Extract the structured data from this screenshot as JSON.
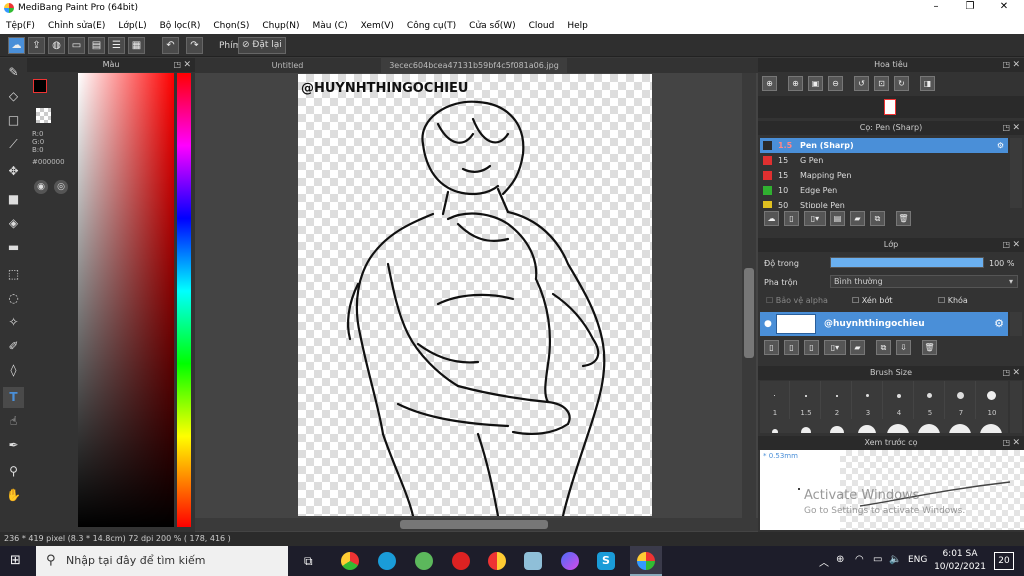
{
  "window": {
    "title": "MediBang Paint Pro (64bit)",
    "min": "–",
    "max": "❐",
    "close": "✕"
  },
  "menu": [
    "Tệp(F)",
    "Chỉnh sửa(E)",
    "Lớp(L)",
    "Bộ lọc(R)",
    "Chọn(S)",
    "Chụp(N)",
    "Màu (C)",
    "Xem(V)",
    "Công cụ(T)",
    "Cửa sổ(W)",
    "Cloud",
    "Help"
  ],
  "toolbar": {
    "phim": "Phím",
    "reset": "Đặt lại"
  },
  "color_panel": {
    "title": "Màu",
    "r": "R:0",
    "g": "G:0",
    "b": "B:0",
    "hex": "#000000"
  },
  "tabs": [
    "Untitled",
    "3ecec604bcea47131b59bf4c5f081a06.jpg"
  ],
  "canvas": {
    "watermark": "@HUYNHTHINGOCHIEU"
  },
  "status": "236 * 419 pixel  (8.3 * 14.8cm)  72 dpi  200 %  ( 178, 416 )",
  "navigator": {
    "title": "Hoa tiêu"
  },
  "brush_panel": {
    "title": "Cọ: Pen (Sharp)",
    "items": [
      {
        "size": "1.5",
        "name": "Pen (Sharp)",
        "color": "#2a2a2a"
      },
      {
        "size": "15",
        "name": "G Pen",
        "color": "#e03030"
      },
      {
        "size": "15",
        "name": "Mapping Pen",
        "color": "#e03030"
      },
      {
        "size": "10",
        "name": "Edge Pen",
        "color": "#30b030"
      },
      {
        "size": "50",
        "name": "Stipple Pen",
        "color": "#e0c020"
      }
    ]
  },
  "layer_panel": {
    "title": "Lớp",
    "opacity_label": "Độ trong",
    "opacity_value": "100 %",
    "blend_label": "Pha trộn",
    "blend_value": "Bình thường",
    "protect_alpha": "Bảo vệ alpha",
    "clipping": "Xén bớt",
    "lock": "Khóa",
    "layer_name": "@huynhthingochieu"
  },
  "brush_size": {
    "title": "Brush Size",
    "sizes": [
      "1",
      "1.5",
      "2",
      "3",
      "4",
      "5",
      "7",
      "10"
    ]
  },
  "preview": {
    "title": "Xem trước cọ",
    "size": "* 0.53mm",
    "activate": "Activate Windows",
    "activate_sub": "Go to Settings to activate Windows."
  },
  "taskbar": {
    "search": "Nhập tại đây để tìm kiếm",
    "lang": "ENG",
    "time": "6:01 SA",
    "date": "10/02/2021",
    "notif": "20"
  }
}
